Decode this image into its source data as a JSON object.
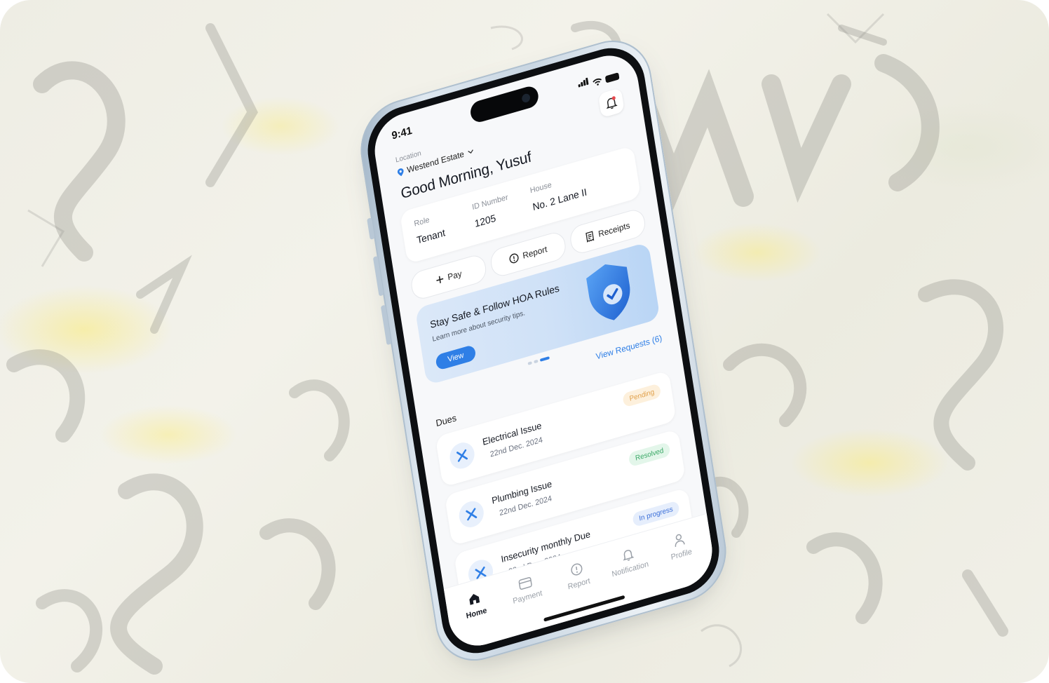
{
  "status_bar": {
    "time": "9:41"
  },
  "header": {
    "location_label": "Location",
    "location_value": "Westend Estate",
    "greeting": "Good Morning, Yusuf"
  },
  "info": {
    "role_label": "Role",
    "role_value": "Tenant",
    "id_label": "ID Number",
    "id_value": "1205",
    "house_label": "House",
    "house_value": "No. 2 Lane II"
  },
  "actions": [
    {
      "label": "Pay",
      "icon": "plus-icon"
    },
    {
      "label": "Report",
      "icon": "alert-circle-icon"
    },
    {
      "label": "Receipts",
      "icon": "receipt-icon"
    }
  ],
  "banner": {
    "title": "Stay Safe & Follow HOA Rules",
    "subtitle": "Learn more about security tips.",
    "button": "View",
    "carousel_active_index": 2,
    "carousel_count": 3
  },
  "requests": {
    "link": "View Requests (6)"
  },
  "dues": {
    "title": "Dues",
    "items": [
      {
        "name": "Electrical Issue",
        "date": "22nd Dec. 2024",
        "status": "Pending"
      },
      {
        "name": "Plumbing Issue",
        "date": "22nd Dec. 2024",
        "status": "Resolved"
      },
      {
        "name": "Insecurity monthly Due",
        "date": "22nd Dec. 2024",
        "status": "In progress"
      }
    ]
  },
  "tabs": [
    {
      "label": "Home",
      "icon": "home-icon",
      "active": true
    },
    {
      "label": "Payment",
      "icon": "card-icon",
      "active": false
    },
    {
      "label": "Report",
      "icon": "alert-circle-icon",
      "active": false
    },
    {
      "label": "Notification",
      "icon": "bell-icon",
      "active": false
    },
    {
      "label": "Profile",
      "icon": "user-icon",
      "active": false
    }
  ],
  "colors": {
    "accent": "#2f7fe6",
    "pending_bg": "#fdf0dc",
    "pending_fg": "#e0a04a",
    "resolved_bg": "#e3f6ea",
    "resolved_fg": "#3aa866",
    "progress_bg": "#e6eefc",
    "progress_fg": "#3b6fd8"
  }
}
